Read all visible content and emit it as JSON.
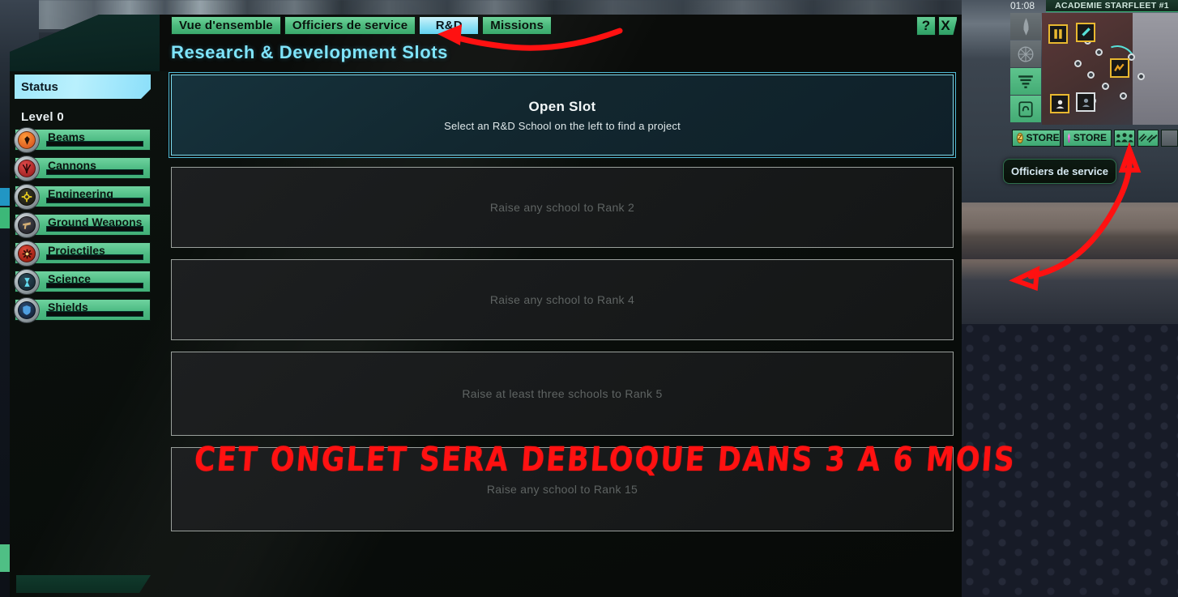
{
  "window": {
    "page_title": "Research & Development Slots",
    "help_label": "?",
    "close_label": "X"
  },
  "tabs": [
    {
      "label": "Vue d'ensemble",
      "active": false
    },
    {
      "label": "Officiers de service",
      "active": false
    },
    {
      "label": "R&D",
      "active": true
    },
    {
      "label": "Missions",
      "active": false
    }
  ],
  "sidebar": {
    "status_header": "Status",
    "level_label": "Level 0",
    "schools": [
      {
        "label": "Beams",
        "icon": "beams-icon",
        "color": "#e8641e",
        "progress": 0
      },
      {
        "label": "Cannons",
        "icon": "cannons-icon",
        "color": "#c42a2a",
        "progress": 0
      },
      {
        "label": "Engineering",
        "icon": "engineering-icon",
        "color": "#e8c81e",
        "progress": 0
      },
      {
        "label": "Ground Weapons",
        "icon": "ground-weapons-icon",
        "color": "#c8a06a",
        "progress": 0
      },
      {
        "label": "Projectiles",
        "icon": "projectiles-icon",
        "color": "#e03a2a",
        "progress": 0
      },
      {
        "label": "Science",
        "icon": "science-icon",
        "color": "#45c8e0",
        "progress": 0
      },
      {
        "label": "Shields",
        "icon": "shields-icon",
        "color": "#2f74c8",
        "progress": 0
      }
    ]
  },
  "slots": [
    {
      "state": "open",
      "title": "Open Slot",
      "subtitle": "Select an R&D School on the left to find a project"
    },
    {
      "state": "locked",
      "requirement": "Raise any school to Rank 2"
    },
    {
      "state": "locked",
      "requirement": "Raise any school to Rank 4"
    },
    {
      "state": "locked",
      "requirement": "Raise at least three schools to Rank 5"
    },
    {
      "state": "locked",
      "requirement": "Raise any school to Rank 15"
    }
  ],
  "hud": {
    "timer": "01:08",
    "location_title": "ACADEMIE STARFLEET #1",
    "store_primary": "STORE",
    "store_secondary": "STORE",
    "rail_icons": [
      "ship-icon",
      "starburst-icon",
      "signal-icon",
      "comms-icon"
    ],
    "bottom_icons": [
      "crew-icon",
      "ships-icon",
      "moon-icon"
    ]
  },
  "tooltip": {
    "text": "Officiers de service"
  },
  "annotations": {
    "handwritten_note": "CET ONGLET SERA DEBLOQUE DANS 3 A 6 MOIS",
    "arrow_tab_color": "#ff1111",
    "arrow_hud_color": "#ff1111"
  },
  "colors": {
    "accent_cyan": "#7fe4fb",
    "tab_green": "#4cba7d",
    "tab_active": "#8fe0f4",
    "annotation_red": "#ff1111"
  }
}
